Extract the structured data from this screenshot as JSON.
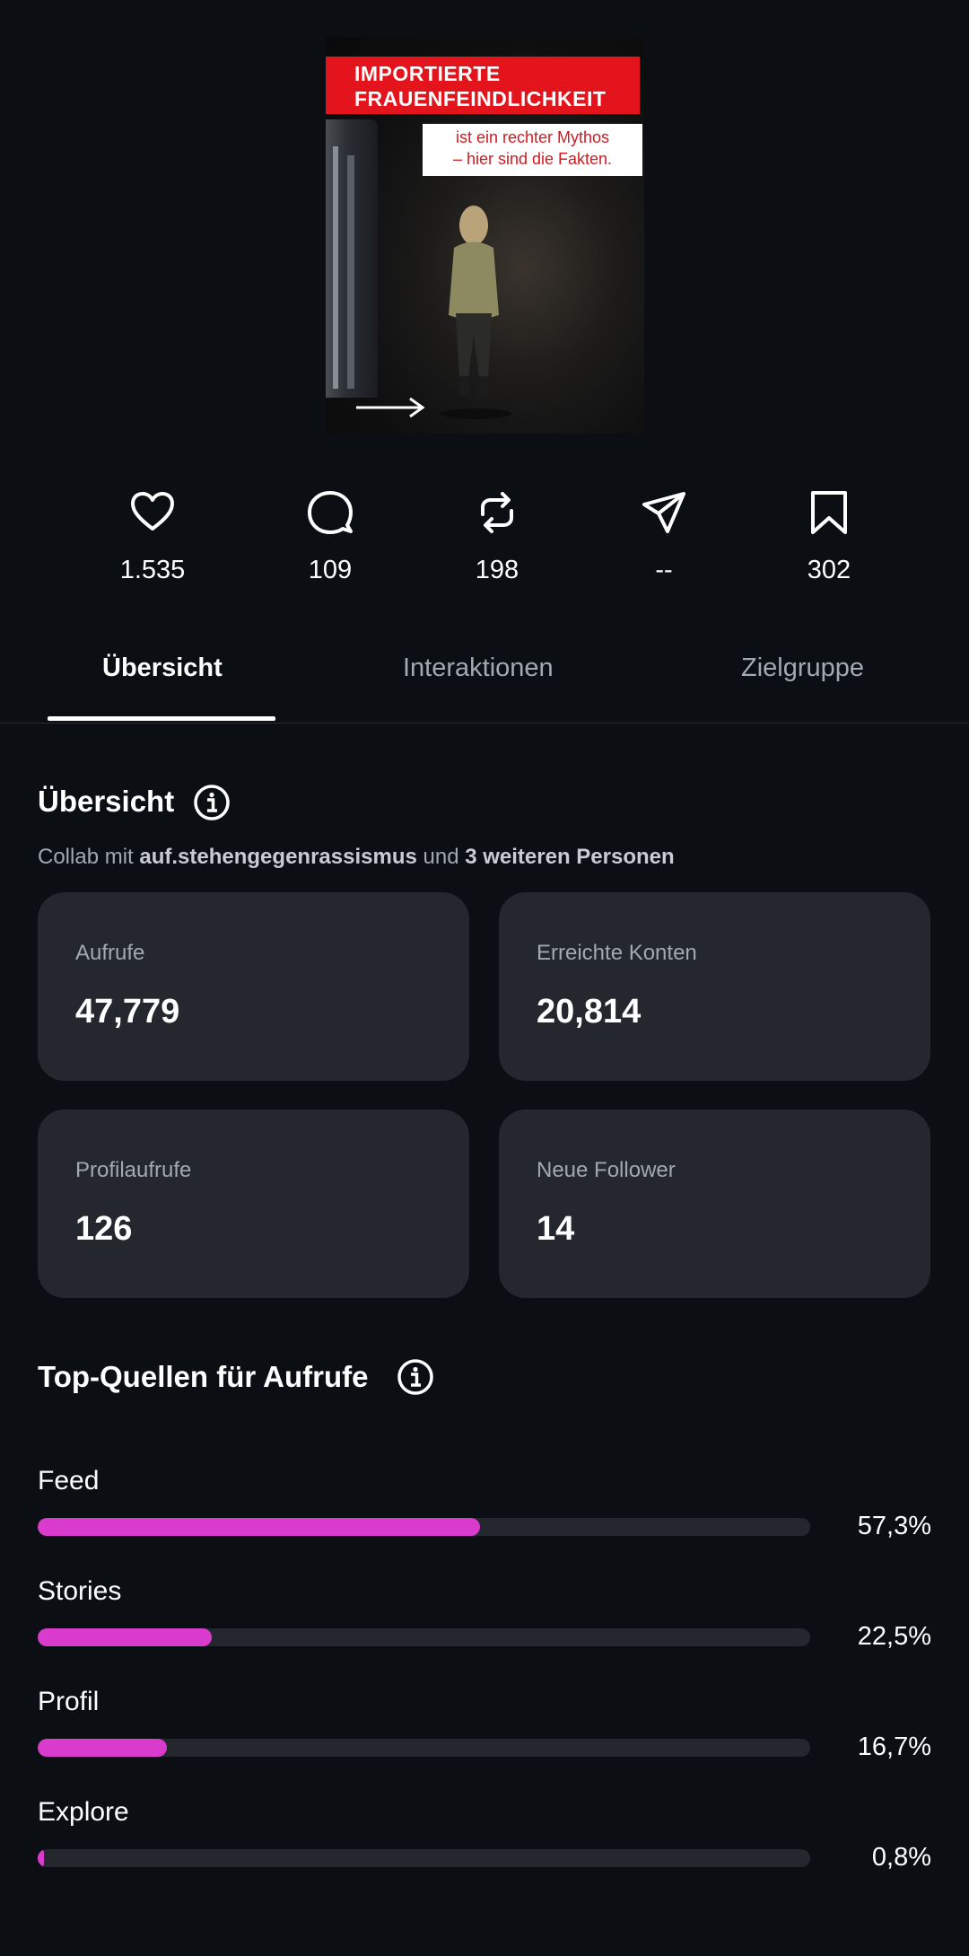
{
  "post": {
    "headline_line1": "IMPORTIERTE",
    "headline_line2": "FRAUENFEINDLICHKEIT",
    "sub_line1": "ist ein rechter Mythos",
    "sub_line2": "– hier sind die Fakten.",
    "icon": "arrow-right-icon",
    "colors": {
      "headline_bg": "#e3141b",
      "sub_text": "#d01a20"
    }
  },
  "stats": [
    {
      "icon": "heart-icon",
      "value": "1.535"
    },
    {
      "icon": "comment-icon",
      "value": "109"
    },
    {
      "icon": "repost-icon",
      "value": "198"
    },
    {
      "icon": "share-icon",
      "value": "--"
    },
    {
      "icon": "bookmark-icon",
      "value": "302"
    }
  ],
  "tabs": [
    {
      "label": "Übersicht",
      "active": true
    },
    {
      "label": "Interaktionen",
      "active": false
    },
    {
      "label": "Zielgruppe",
      "active": false
    }
  ],
  "overview": {
    "title": "Übersicht",
    "collab_prefix": "Collab mit ",
    "collab_account": "auf.stehengegenrassismus",
    "collab_middle": " und ",
    "collab_others": "3 weiteren Personen",
    "cards": [
      {
        "label": "Aufrufe",
        "value": "47,779"
      },
      {
        "label": "Erreichte Konten",
        "value": "20,814"
      },
      {
        "label": "Profilaufrufe",
        "value": "126"
      },
      {
        "label": "Neue Follower",
        "value": "14"
      }
    ]
  },
  "top_sources": {
    "title": "Top-Quellen für Aufrufe",
    "accent_color": "#d93ccd",
    "items": [
      {
        "label": "Feed",
        "percent_text": "57,3%",
        "percent": 57.3
      },
      {
        "label": "Stories",
        "percent_text": "22,5%",
        "percent": 22.5
      },
      {
        "label": "Profil",
        "percent_text": "16,7%",
        "percent": 16.7
      },
      {
        "label": "Explore",
        "percent_text": "0,8%",
        "percent": 0.8
      }
    ]
  }
}
